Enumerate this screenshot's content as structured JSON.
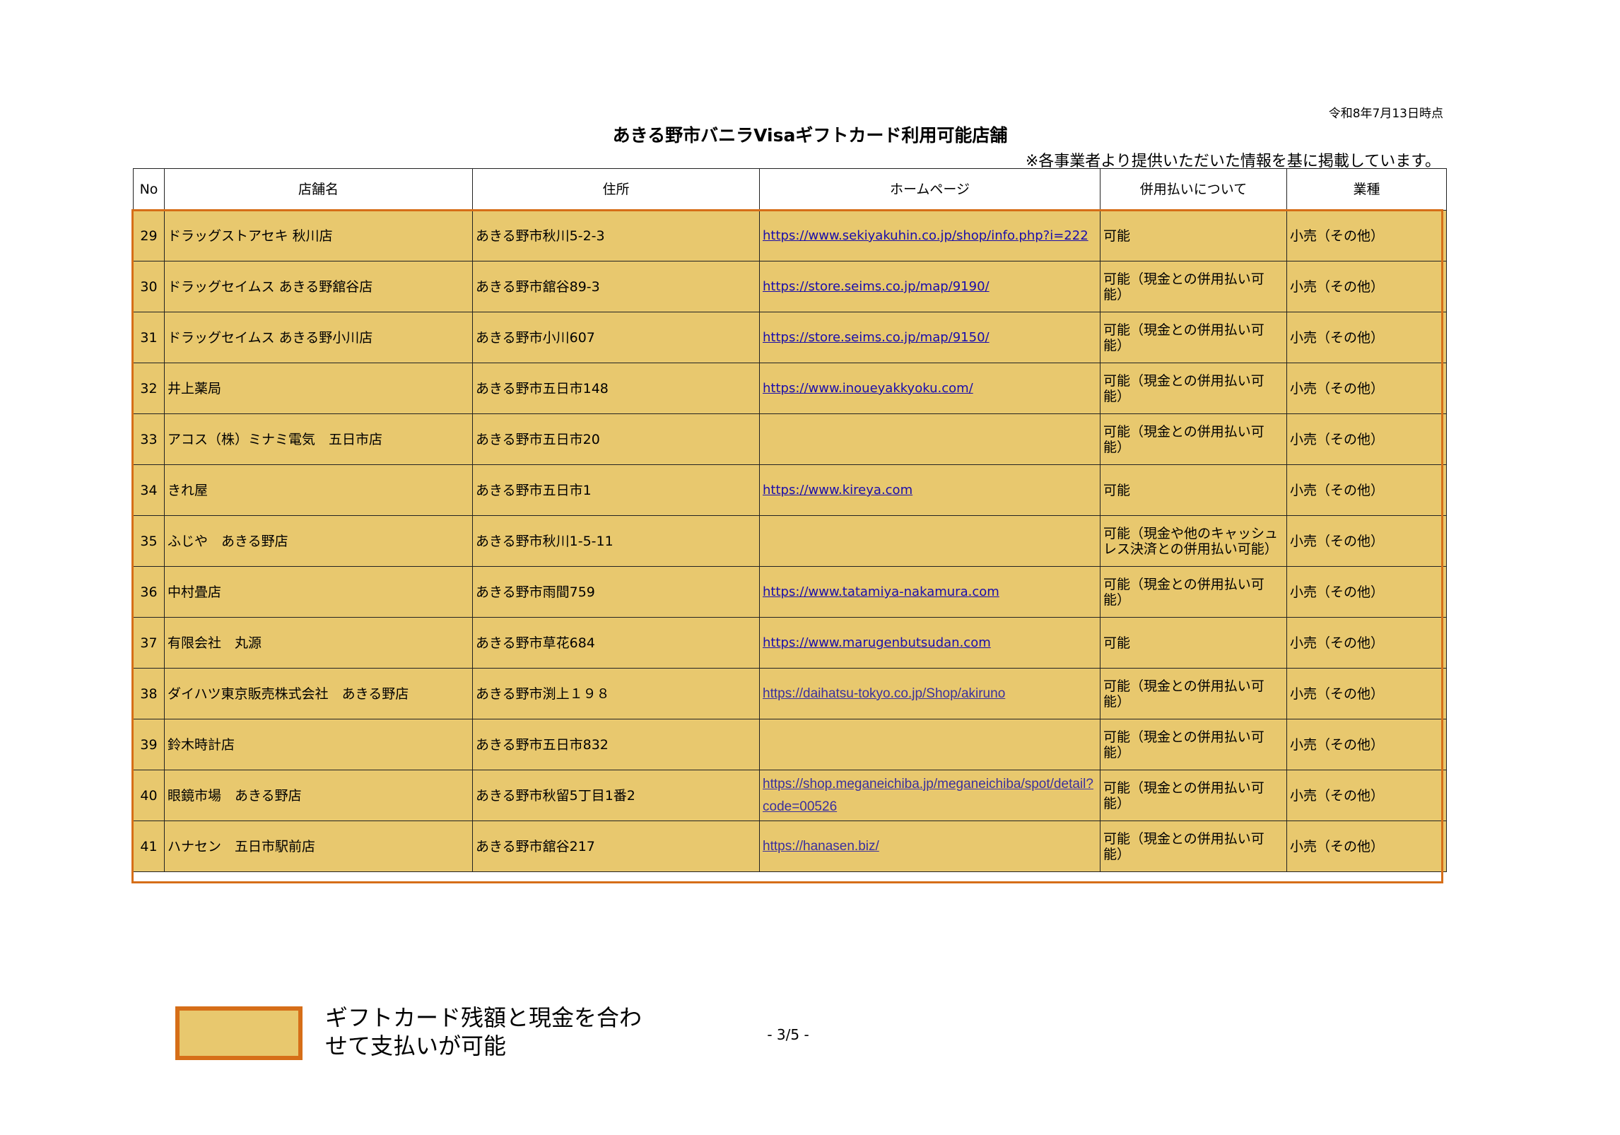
{
  "header": {
    "date_note": "令和8年7月13日時点",
    "title": "あきる野市バニラVisaギフトカード利用可能店舗",
    "source_note": "※各事業者より提供いただいた情報を基に掲載しています。"
  },
  "table": {
    "columns": [
      "No",
      "店舗名",
      "住所",
      "ホームページ",
      "併用払いについて",
      "業種"
    ],
    "rows": [
      {
        "no": "29",
        "name": "ドラッグストアセキ 秋川店",
        "address": "あきる野市秋川5-2-3",
        "homepage": "https://www.sekiyakuhin.co.jp/shop/info.php?i=222",
        "payment": "可能",
        "category": "小売（その他）"
      },
      {
        "no": "30",
        "name": "ドラッグセイムス あきる野舘谷店",
        "address": "あきる野市舘谷89-3",
        "homepage": "https://store.seims.co.jp/map/9190/",
        "payment": "可能（現金との併用払い可能）",
        "category": "小売（その他）"
      },
      {
        "no": "31",
        "name": "ドラッグセイムス あきる野小川店",
        "address": "あきる野市小川607",
        "homepage": "https://store.seims.co.jp/map/9150/",
        "payment": "可能（現金との併用払い可能）",
        "category": "小売（その他）"
      },
      {
        "no": "32",
        "name": "井上薬局",
        "address": "あきる野市五日市148",
        "homepage": "https://www.inoueyakkyoku.com/",
        "payment": "可能（現金との併用払い可能）",
        "category": "小売（その他）"
      },
      {
        "no": "33",
        "name": "アコス（株）ミナミ電気　五日市店",
        "address": "あきる野市五日市20",
        "homepage": "",
        "payment": "可能（現金との併用払い可能）",
        "category": "小売（その他）"
      },
      {
        "no": "34",
        "name": "きれ屋",
        "address": "あきる野市五日市1",
        "homepage": "https://www.kireya.com",
        "payment": "可能",
        "category": "小売（その他）"
      },
      {
        "no": "35",
        "name": "ふじや　あきる野店",
        "address": "あきる野市秋川1-5-11",
        "homepage": "",
        "payment": "可能（現金や他のキャッシュレス決済との併用払い可能）",
        "category": "小売（その他）"
      },
      {
        "no": "36",
        "name": "中村畳店",
        "address": "あきる野市雨間759",
        "homepage": "https://www.tatamiya-nakamura.com",
        "payment": "可能（現金との併用払い可能）",
        "category": "小売（その他）"
      },
      {
        "no": "37",
        "name": "有限会社　丸源",
        "address": "あきる野市草花684",
        "homepage": "https://www.marugenbutsudan.com",
        "payment": "可能",
        "category": "小売（その他）"
      },
      {
        "no": "38",
        "name": "ダイハツ東京販売株式会社　あきる野店",
        "address": "あきる野市渕上１９８",
        "homepage": "https://daihatsu-tokyo.co.jp/Shop/akiruno",
        "payment": "可能（現金との併用払い可能）",
        "category": "小売（その他）"
      },
      {
        "no": "39",
        "name": "鈴木時計店",
        "address": "あきる野市五日市832",
        "homepage": "",
        "payment": "可能（現金との併用払い可能）",
        "category": "小売（その他）"
      },
      {
        "no": "40",
        "name": "眼鏡市場　あきる野店",
        "address": "あきる野市秋留5丁目1番2",
        "homepage": "https://shop.meganeichiba.jp/meganeichiba/spot/detail?code=00526",
        "payment": "可能（現金との併用払い可能）",
        "category": "小売（その他）"
      },
      {
        "no": "41",
        "name": "ハナセン　五日市駅前店",
        "address": "あきる野市舘谷217",
        "homepage": "https://hanasen.biz/",
        "payment": "可能（現金との併用払い可能）",
        "category": "小売（その他）"
      }
    ]
  },
  "legend": {
    "text": "ギフトカード残額と現金を合わせて支払いが可能"
  },
  "footer": {
    "page_number": "- 3/5 -"
  },
  "colors": {
    "highlight_fill": "#e8c86e",
    "highlight_border": "#d66e18",
    "link": "#1a0dab"
  }
}
